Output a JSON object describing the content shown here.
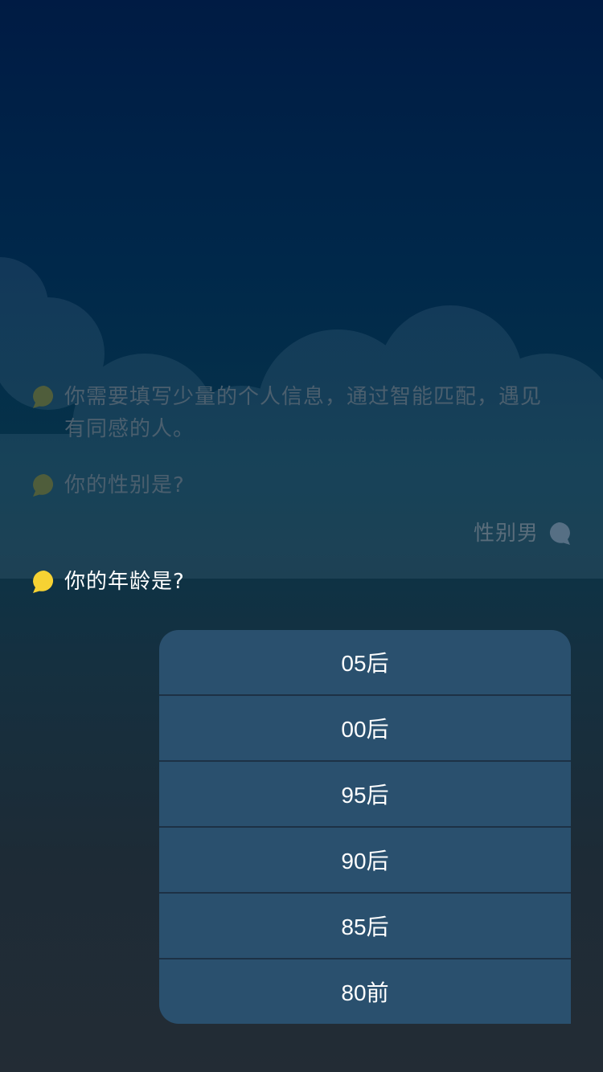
{
  "chat": {
    "intro": "你需要填写少量的个人信息，通过智能匹配，遇见有同感的人。",
    "gender_question": "你的性别是?",
    "gender_reply": "性别男",
    "age_question": "你的年龄是?"
  },
  "age_options": [
    {
      "label": "05后"
    },
    {
      "label": "00后"
    },
    {
      "label": "95后"
    },
    {
      "label": "90后"
    },
    {
      "label": "85后"
    },
    {
      "label": "80前"
    }
  ],
  "colors": {
    "bubble_active": "#f6d233",
    "bubble_inactive": "#4f5d3b",
    "reply_bubble": "#566f84",
    "option_bg": "#2a506e"
  },
  "icons": {
    "question_bubble": "speech-bubble-icon",
    "reply_bubble": "speech-bubble-icon"
  }
}
